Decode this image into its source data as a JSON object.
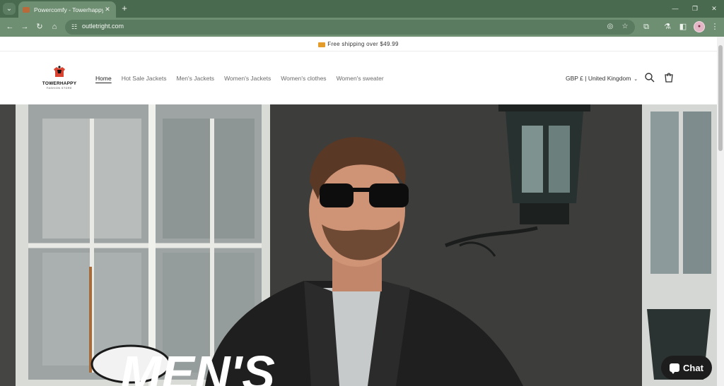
{
  "browser": {
    "tab_title": "Powercomfy - Towerhappy",
    "tab_close": "✕",
    "new_tab": "+",
    "url": "outletright.com",
    "icons": [
      "tab-search-icon",
      "back-icon",
      "forward-icon",
      "reload-icon",
      "home-icon",
      "site-info-icon",
      "eye-off-icon",
      "star-icon",
      "extensions-icon",
      "labs-icon",
      "sidebar-icon",
      "profile-avatar",
      "menu-icon"
    ]
  },
  "announcement": {
    "text": "Free shipping over $49.99"
  },
  "header": {
    "logo_text": "TOWERHAPPY",
    "logo_sub": "FASHION STORE",
    "nav": [
      {
        "label": "Home",
        "active": true
      },
      {
        "label": "Hot Sale Jackets"
      },
      {
        "label": "Men's Jackets"
      },
      {
        "label": "Women's Jackets"
      },
      {
        "label": "Women's clothes"
      },
      {
        "label": "Women's sweater"
      }
    ],
    "currency": "GBP £ | United Kingdom",
    "icons": [
      "chevron-down-icon",
      "search-icon",
      "cart-icon"
    ]
  },
  "hero": {
    "headline": "MEN'S"
  },
  "chat": {
    "label": "Chat"
  },
  "colors": {
    "chrome_dark": "#4a6a4f",
    "chrome_light": "#6f8f73",
    "chat_bg": "#1d1d1d"
  }
}
